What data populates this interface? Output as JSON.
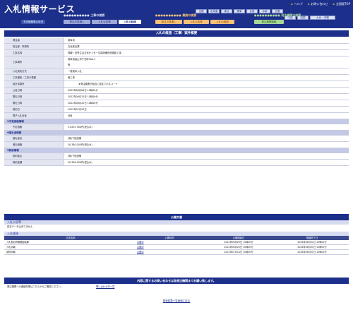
{
  "header": {
    "title": "入札情報サービス",
    "links": [
      "ヘルプ",
      "お問い合わせ",
      "全国版TOP"
    ],
    "regions_top": [
      "全国",
      "北海道",
      "東北",
      "関東",
      "北陸",
      "中部",
      "近畿"
    ],
    "regions_bottom": [
      "中国",
      "四国",
      "九州・沖縄"
    ],
    "groups": [
      {
        "title": "工事の検索",
        "tabs": [
          "発注の見通し",
          "入札公告等",
          "入札の経過"
        ],
        "color": "#1c2f8a",
        "tabcolor": "#9fa9d8"
      },
      {
        "title": "業務の検索",
        "tabs": [
          "発注の見通し",
          "入札公告等",
          "入札の経過"
        ],
        "color": "#e07a10",
        "tabcolor": "#f4c07a"
      },
      {
        "title": "発注機関で検索",
        "tabs": [
          "発注機関情報"
        ],
        "color": "#3a9a2a",
        "tabcolor": "#a8d79a"
      }
    ],
    "sub_tabs": [
      "予定価格等の状況"
    ]
  },
  "main_title": "入札の経過（工事）案件概要",
  "details": [
    {
      "label": "発注者",
      "value": "岐阜県"
    },
    {
      "label": "担当部・事務所",
      "value": "文化総合課"
    },
    {
      "label": "工事名称",
      "value": "飛騨・世界生活文化センター空調設備改修更新工事"
    },
    {
      "label": "工事場所",
      "value": "岐阜県高山市千島町900-1",
      "value2": "等"
    },
    {
      "label": "入札契約方式",
      "value": "一般競争入札"
    },
    {
      "label": "工事種別／工事の業種",
      "value": "管工事"
    },
    {
      "label": "設計書番号",
      "value": "★発注機関が独自に設定されるコード"
    },
    {
      "label": "公告日時",
      "value": "2022年06月06日 10時00分"
    },
    {
      "label": "開札日時",
      "value": "2022年06月13日 10時00分"
    },
    {
      "label": "開札日時",
      "value": "2022年06月20日 10時00分"
    },
    {
      "label": "契約日",
      "value": "2022年07月20日"
    },
    {
      "label": "電子入札対象",
      "value": "対象"
    }
  ],
  "sections": [
    {
      "title": "予定価格情報",
      "rows": [
        {
          "label": "予定価格",
          "value": "51,635,760円(税込み)"
        }
      ]
    },
    {
      "title": "落札者情報",
      "rows": [
        {
          "label": "落札者名",
          "value": "(株)下田設備"
        },
        {
          "label": "落札価格",
          "value": "50,380,000円(税込み)"
        }
      ]
    },
    {
      "title": "契約情報",
      "rows": [
        {
          "label": "契約者名",
          "value": "(株)下田設備"
        },
        {
          "label": "契約金額",
          "value": "50,380,000円(税込み)"
        }
      ]
    }
  ],
  "public_docs": {
    "title": "公開文書",
    "notice_title": "入札公告等",
    "notice_empty": "該当データはありません",
    "history_title": "入札経過",
    "headers": [
      "文書名称",
      "公開状況",
      "公開開始日",
      "掲載終了日"
    ],
    "rows": [
      [
        "入札参加資格確認結果",
        "公開中",
        "2022年06月09日 10時00分",
        "2026年06月01日 10時00分"
      ],
      [
        "入札情報",
        "公開中",
        "2022年06月20日 10時00分",
        "2026年06月01日 10時00分"
      ],
      [
        "契約情報",
        "公開中",
        "2022年07月14日 10時00分",
        "2026年06月01日 10時00分"
      ]
    ]
  },
  "contact": {
    "bar": "内容に関するお問い合わせは各発注機関までお願い致します。",
    "label": "発注機関への連絡先等はこちらからご確認ください。",
    "link": "問い合わせ先一覧"
  },
  "footer_link": "検索結果一覧画面に戻る"
}
